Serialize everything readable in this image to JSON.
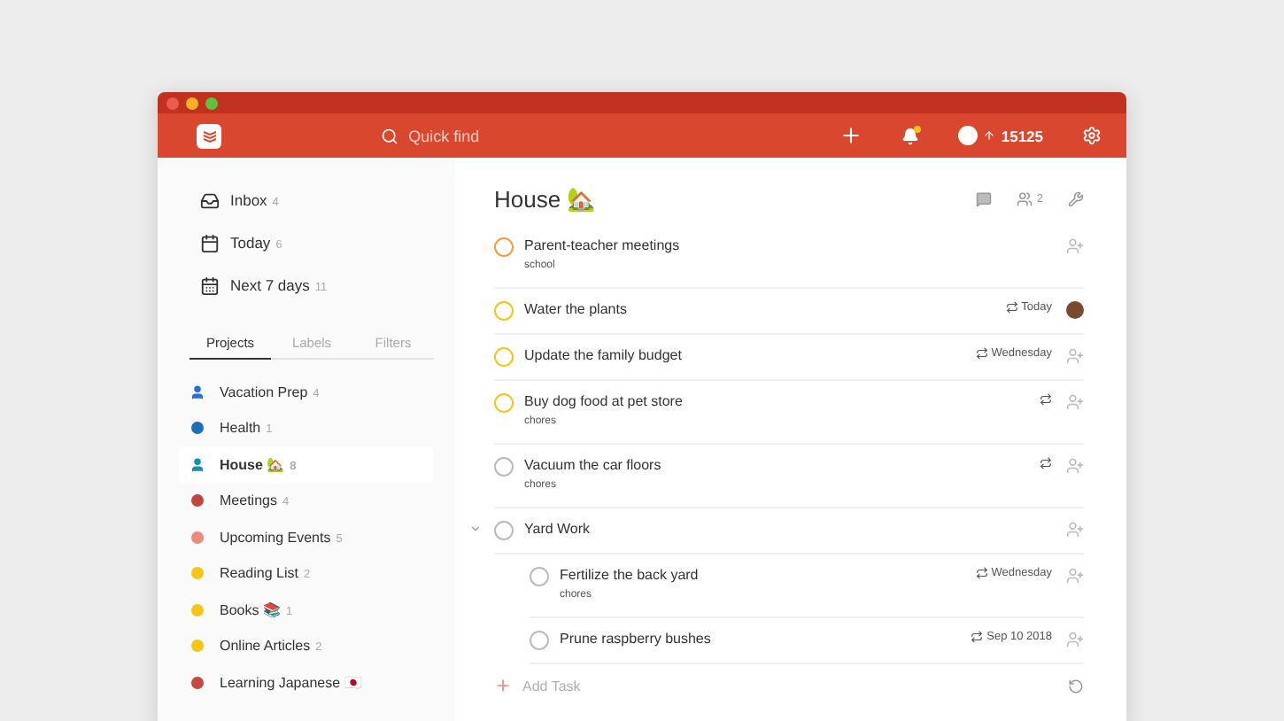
{
  "toolbar": {
    "search": {
      "placeholder": "Quick find"
    },
    "karma": "15125",
    "notifications_unread": true
  },
  "sidebar": {
    "filters": [
      {
        "kind": "inbox",
        "label": "Inbox",
        "count": "4"
      },
      {
        "kind": "today",
        "label": "Today",
        "count": "6"
      },
      {
        "kind": "week",
        "label": "Next 7 days",
        "count": "11"
      }
    ],
    "tabs": [
      {
        "label": "Projects",
        "selected": true
      },
      {
        "label": "Labels",
        "selected": false
      },
      {
        "label": "Filters",
        "selected": false
      }
    ],
    "projects": [
      {
        "name": "Vacation Prep",
        "count": "4",
        "kind": "shared",
        "color": "#246fe0",
        "selected": false
      },
      {
        "name": "Health",
        "count": "1",
        "kind": "dot",
        "color": "#1d6fb8",
        "selected": false
      },
      {
        "name": "House 🏡",
        "count": "8",
        "kind": "shared",
        "color": "#158fad",
        "selected": true
      },
      {
        "name": "Meetings",
        "count": "4",
        "kind": "dot",
        "color": "#c0463b",
        "selected": false
      },
      {
        "name": "Upcoming Events",
        "count": "5",
        "kind": "dot",
        "color": "#ee8a7a",
        "selected": false
      },
      {
        "name": "Reading List",
        "count": "2",
        "kind": "dot",
        "color": "#f5c518",
        "selected": false
      },
      {
        "name": "Books 📚",
        "count": "1",
        "kind": "dot",
        "color": "#f5c518",
        "selected": false
      },
      {
        "name": "Online Articles",
        "count": "2",
        "kind": "dot",
        "color": "#f5c518",
        "selected": false
      },
      {
        "name": "Learning Japanese 🇯🇵",
        "kind": "dot",
        "color": "#c9473c",
        "selected": false
      }
    ]
  },
  "project": {
    "title": "House 🏡",
    "collaborators": "2",
    "tasks": [
      {
        "title": "Parent-teacher meetings",
        "label": "school",
        "color": "#f29f39",
        "recurring": false,
        "assigned": false
      },
      {
        "title": "Water the plants",
        "color": "#f5c518",
        "recurring": true,
        "due": "Today",
        "assigned": true
      },
      {
        "title": "Update the family budget",
        "color": "#f5c518",
        "recurring": true,
        "due": "Wednesday",
        "assigned": false
      },
      {
        "title": "Buy dog food at pet store",
        "label": "chores",
        "color": "#f5c518",
        "recurring": true,
        "assigned": false
      },
      {
        "title": "Vacuum the car floors",
        "label": "chores",
        "color": "#bbbbbb",
        "recurring": true,
        "assigned": false
      },
      {
        "title": "Yard Work",
        "color": "#bbbbbb",
        "recurring": false,
        "assigned": false,
        "expanded": true,
        "children": [
          {
            "title": "Fertilize the back yard",
            "label": "chores",
            "color": "#bbbbbb",
            "recurring": true,
            "due": "Wednesday",
            "assigned": false
          },
          {
            "title": "Prune raspberry bushes",
            "color": "#bbbbbb",
            "recurring": true,
            "due": "Sep 10 2018",
            "assigned": false
          }
        ]
      }
    ],
    "add_task": "Add Task"
  }
}
